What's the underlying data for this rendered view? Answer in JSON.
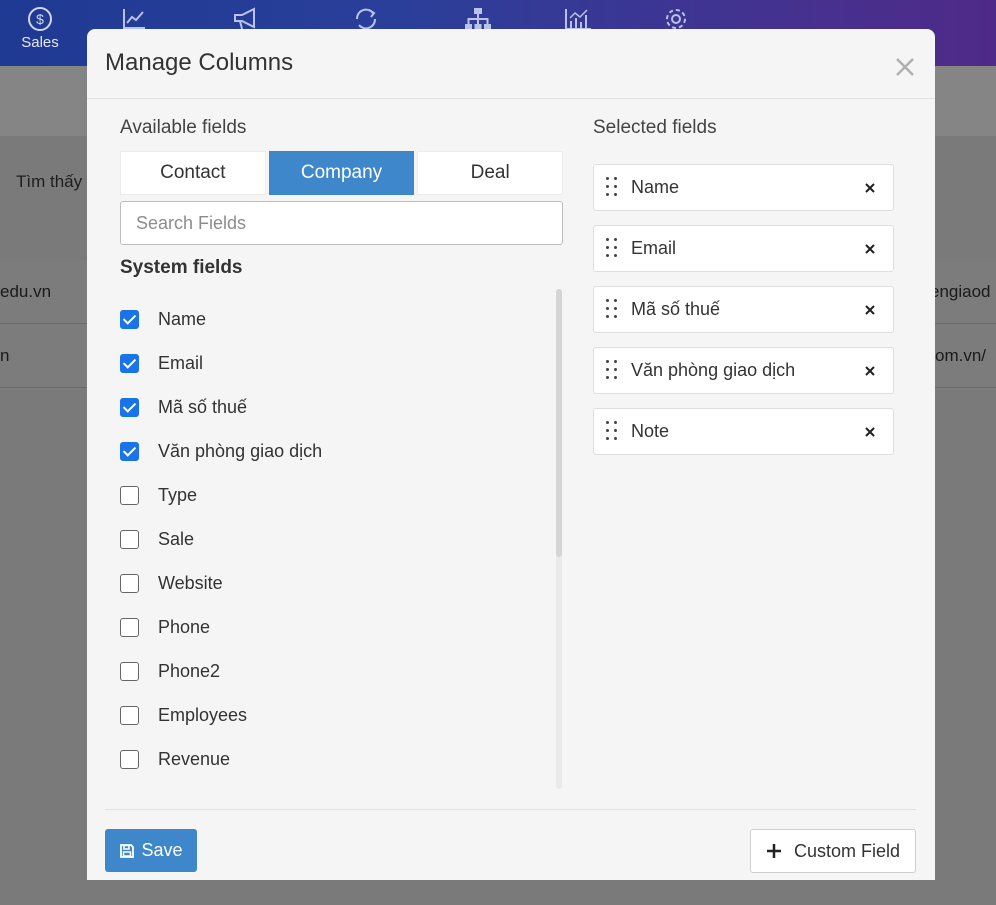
{
  "app": {
    "nav": [
      {
        "label": "Sales",
        "icon": "dollar-circle-icon"
      },
      {
        "label": "",
        "icon": "chart-line-icon"
      },
      {
        "label": "",
        "icon": "megaphone-icon"
      },
      {
        "label": "",
        "icon": "repeat-icon"
      },
      {
        "label": "",
        "icon": "org-chart-icon"
      },
      {
        "label": "",
        "icon": "analytics-icon"
      },
      {
        "label": "",
        "icon": "gear-icon"
      }
    ],
    "found_text": "Tìm thấy",
    "rows": [
      {
        "left": "edu.vn",
        "right": "engiaod"
      },
      {
        "left": "n",
        "right": "om.vn/"
      }
    ]
  },
  "modal": {
    "title": "Manage Columns",
    "available_label": "Available fields",
    "selected_label": "Selected fields",
    "tabs": [
      {
        "label": "Contact",
        "active": false
      },
      {
        "label": "Company",
        "active": true
      },
      {
        "label": "Deal",
        "active": false
      }
    ],
    "search_placeholder": "Search Fields",
    "group_title": "System fields",
    "fields": [
      {
        "name": "Name",
        "checked": true
      },
      {
        "name": "Email",
        "checked": true
      },
      {
        "name": "Mã số thuế",
        "checked": true
      },
      {
        "name": "Văn phòng giao dịch",
        "checked": true
      },
      {
        "name": "Type",
        "checked": false
      },
      {
        "name": "Sale",
        "checked": false
      },
      {
        "name": "Website",
        "checked": false
      },
      {
        "name": "Phone",
        "checked": false
      },
      {
        "name": "Phone2",
        "checked": false
      },
      {
        "name": "Employees",
        "checked": false
      },
      {
        "name": "Revenue",
        "checked": false
      }
    ],
    "selected": [
      "Name",
      "Email",
      "Mã số thuế",
      "Văn phòng giao dịch",
      "Note"
    ],
    "save_label": "Save",
    "custom_field_label": "Custom Field",
    "accent_color": "#3d87ca",
    "checkbox_color": "#1a73e8"
  }
}
